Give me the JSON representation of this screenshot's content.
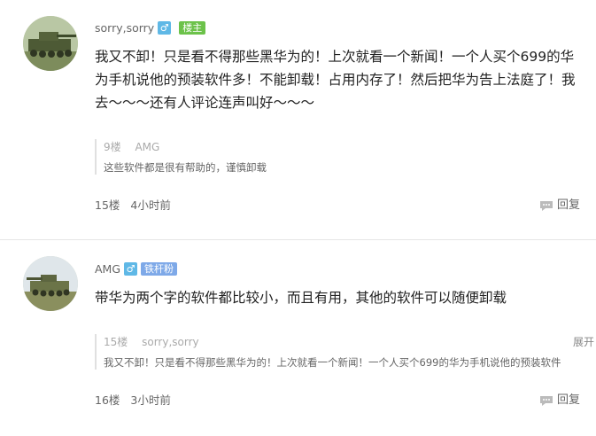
{
  "posts": [
    {
      "username": "sorry,sorry",
      "gender_icon": "♂",
      "badge": "楼主",
      "content": "我又不卸！只是看不得那些黑华为的！上次就看一个新闻！一个人买个699的华为手机说他的预装软件多！不能卸载！占用内存了！然后把华为告上法庭了！我去～～～还有人评论连声叫好～～～",
      "quote": {
        "floor": "9楼",
        "author": "AMG",
        "expand": "",
        "text": "这些软件都是很有帮助的，谨慎卸载"
      },
      "floor": "15楼",
      "time": "4小时前",
      "reply_label": "回复"
    },
    {
      "username": "AMG",
      "gender_icon": "♂",
      "badge": "铁杆粉",
      "content": "带华为两个字的软件都比较小，而且有用，其他的软件可以随便卸载",
      "quote": {
        "floor": "15楼",
        "author": "sorry,sorry",
        "expand": "展开",
        "text": "我又不卸！只是看不得那些黑华为的！上次就看一个新闻！一个人买个699的华为手机说他的预装软件"
      },
      "floor": "16楼",
      "time": "3小时前",
      "reply_label": "回复"
    }
  ],
  "colors": {
    "gender": "#5fb8e6",
    "badge_owner": "#6cc24a",
    "badge_fan": "#7ea9e8"
  },
  "icons": {
    "gender": "male-icon",
    "reply": "comment-bubble-icon",
    "avatar": "tank-avatar"
  }
}
